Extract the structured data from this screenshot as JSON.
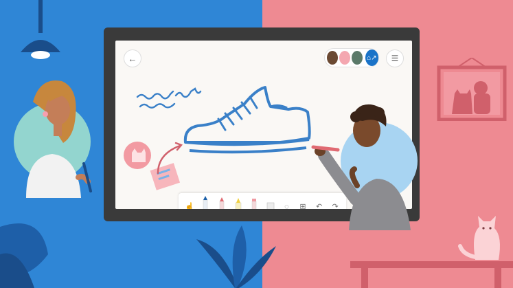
{
  "app": {
    "name": "Whiteboard"
  },
  "header": {
    "back_icon": "←",
    "menu_icon": "☰",
    "share_icon": "⌂↗"
  },
  "participants": [
    {
      "name": "participant-1",
      "color": "#6b4a33"
    },
    {
      "name": "participant-2",
      "color": "#f4a7b0"
    },
    {
      "name": "participant-3",
      "color": "#5b7a6a"
    }
  ],
  "toolbar": {
    "tools": [
      {
        "name": "touch-icon",
        "glyph": "☝"
      },
      {
        "name": "pen-blue-icon",
        "glyph": ""
      },
      {
        "name": "pen-red-icon",
        "glyph": ""
      },
      {
        "name": "highlighter-yellow-icon",
        "glyph": ""
      },
      {
        "name": "pen-pink-icon",
        "glyph": ""
      },
      {
        "name": "eraser-icon",
        "glyph": ""
      },
      {
        "name": "lasso-icon",
        "glyph": "◌"
      },
      {
        "name": "add-icon",
        "glyph": "⊞"
      },
      {
        "name": "undo-icon",
        "glyph": "↶"
      },
      {
        "name": "redo-icon",
        "glyph": "↷"
      }
    ]
  },
  "colors": {
    "left_bg": "#2f86d6",
    "right_bg": "#ee8a92",
    "ink_blue": "#3a80c8",
    "accent_blue": "#1a73c8"
  }
}
